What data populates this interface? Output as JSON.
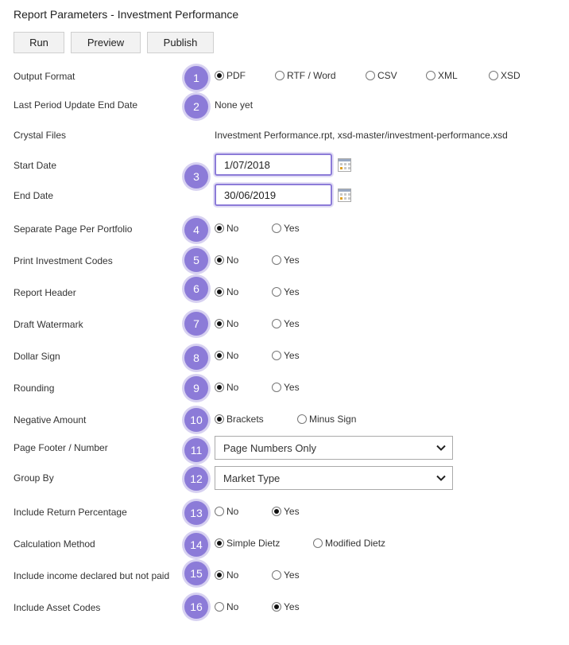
{
  "title": "Report Parameters - Investment Performance",
  "toolbar": {
    "run": "Run",
    "preview": "Preview",
    "publish": "Publish"
  },
  "badges": [
    "1",
    "2",
    "3",
    "4",
    "5",
    "6",
    "7",
    "8",
    "9",
    "10",
    "11",
    "12",
    "13",
    "14",
    "15",
    "16"
  ],
  "output_format": {
    "label": "Output Format",
    "options": [
      "PDF",
      "RTF / Word",
      "CSV",
      "XML",
      "XSD"
    ],
    "selected": "PDF"
  },
  "last_period": {
    "label": "Last Period Update End Date",
    "value": "None yet"
  },
  "crystal_files": {
    "label": "Crystal Files",
    "value": "Investment Performance.rpt, xsd-master/investment-performance.xsd"
  },
  "start_date": {
    "label": "Start Date",
    "value": "1/07/2018"
  },
  "end_date": {
    "label": "End Date",
    "value": "30/06/2019"
  },
  "separate_page": {
    "label": "Separate Page Per Portfolio",
    "options": [
      "No",
      "Yes"
    ],
    "selected": "No"
  },
  "print_codes": {
    "label": "Print Investment Codes",
    "options": [
      "No",
      "Yes"
    ],
    "selected": "No"
  },
  "report_header": {
    "label": "Report Header",
    "options": [
      "No",
      "Yes"
    ],
    "selected": "No"
  },
  "draft_watermark": {
    "label": "Draft Watermark",
    "options": [
      "No",
      "Yes"
    ],
    "selected": "No"
  },
  "dollar_sign": {
    "label": "Dollar Sign",
    "options": [
      "No",
      "Yes"
    ],
    "selected": "No"
  },
  "rounding": {
    "label": "Rounding",
    "options": [
      "No",
      "Yes"
    ],
    "selected": "No"
  },
  "negative_amount": {
    "label": "Negative Amount",
    "options": [
      "Brackets",
      "Minus Sign"
    ],
    "selected": "Brackets"
  },
  "page_footer": {
    "label": "Page Footer / Number",
    "value": "Page Numbers Only"
  },
  "group_by": {
    "label": "Group By",
    "value": "Market Type"
  },
  "include_return": {
    "label": "Include Return Percentage",
    "options": [
      "No",
      "Yes"
    ],
    "selected": "Yes"
  },
  "calc_method": {
    "label": "Calculation Method",
    "options": [
      "Simple Dietz",
      "Modified Dietz"
    ],
    "selected": "Simple Dietz"
  },
  "income_declared": {
    "label": "Include income declared but not paid",
    "options": [
      "No",
      "Yes"
    ],
    "selected": "No"
  },
  "asset_codes": {
    "label": "Include Asset Codes",
    "options": [
      "No",
      "Yes"
    ],
    "selected": "Yes"
  },
  "colors": {
    "badge": "#8c7bd8",
    "focus_border": "#8c7bd8",
    "button_bg": "#f2f2f2"
  },
  "icons": {
    "calendar": "calendar-icon",
    "dropdown": "chevron-down-icon"
  }
}
